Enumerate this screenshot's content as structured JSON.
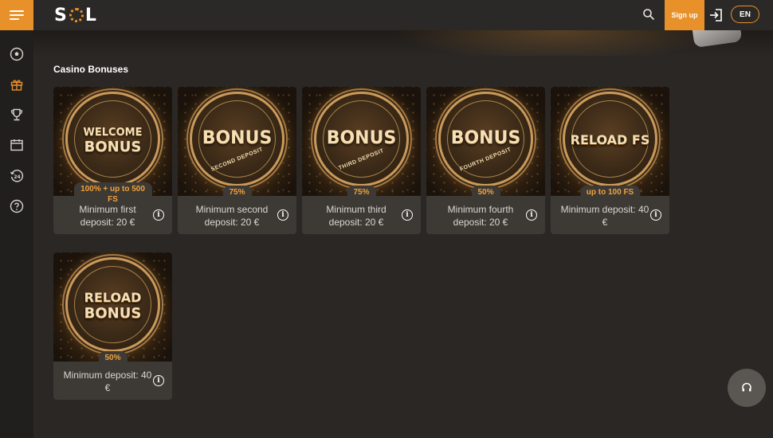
{
  "brand": {
    "logo_text_left": "S",
    "logo_text_right": "L",
    "accent": "#e8902a"
  },
  "topbar": {
    "menu_icon": "hamburger-icon",
    "search_icon": "search-icon",
    "signup_label": "Sign up",
    "login_icon": "login-icon",
    "language": "EN"
  },
  "sidebar": {
    "items": [
      {
        "name": "sports",
        "icon": "soccer-ball-icon"
      },
      {
        "name": "bonuses",
        "icon": "gift-icon",
        "active": true
      },
      {
        "name": "tournaments",
        "icon": "trophy-icon"
      },
      {
        "name": "calendar",
        "icon": "calendar-icon"
      },
      {
        "name": "support-24",
        "icon": "clock-24-icon"
      },
      {
        "name": "help",
        "icon": "question-icon"
      }
    ]
  },
  "main": {
    "section_title": "Casino Bonuses",
    "cards": [
      {
        "medal_line1": "WELCOME",
        "medal_line2": "BONUS",
        "medal_sub": "",
        "badge": "100% + up to 500 FS",
        "description": "Minimum first deposit: 20 €"
      },
      {
        "medal_line1": "BONUS",
        "medal_line2": "",
        "medal_sub": "SECOND DEPOSIT",
        "badge": "75%",
        "description": "Minimum second deposit: 20 €"
      },
      {
        "medal_line1": "BONUS",
        "medal_line2": "",
        "medal_sub": "THIRD DEPOSIT",
        "badge": "75%",
        "description": "Minimum third deposit: 20 €"
      },
      {
        "medal_line1": "BONUS",
        "medal_line2": "",
        "medal_sub": "FOURTH DEPOSIT",
        "badge": "50%",
        "description": "Minimum fourth deposit: 20 €"
      },
      {
        "medal_line1": "RELOAD FS",
        "medal_line2": "",
        "medal_sub": "",
        "badge": "up to 100 FS",
        "description": "Minimum deposit: 40 €"
      },
      {
        "medal_line1": "RELOAD",
        "medal_line2": "BONUS",
        "medal_sub": "",
        "badge": "50%",
        "description": "Minimum deposit: 40 €"
      }
    ],
    "info_icon": "info-icon"
  },
  "support": {
    "icon": "headset-icon"
  }
}
